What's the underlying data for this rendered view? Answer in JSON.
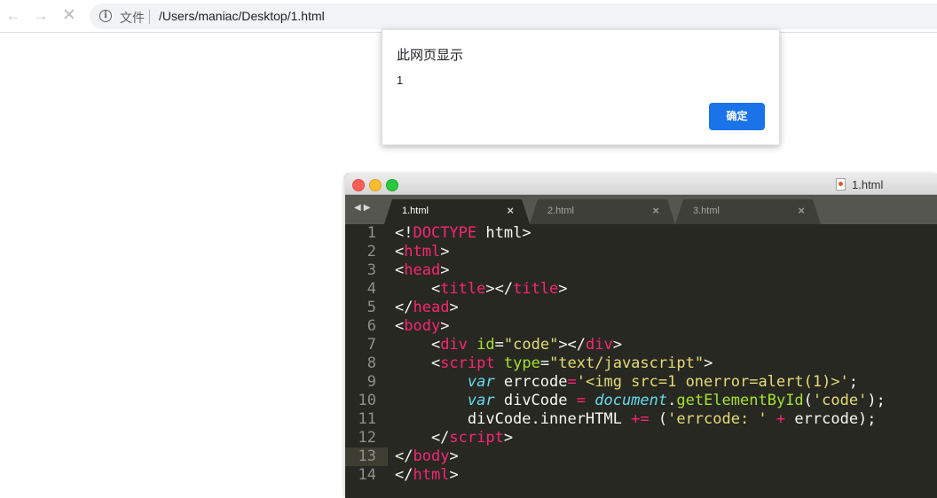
{
  "browser": {
    "scheme_label": "文件",
    "url": "/Users/maniac/Desktop/1.html"
  },
  "alert": {
    "title": "此网页显示",
    "message": "1",
    "ok_label": "确定"
  },
  "editor": {
    "window_title": "1.html",
    "tabs": [
      {
        "label": "1.html",
        "active": true
      },
      {
        "label": "2.html",
        "active": false
      },
      {
        "label": "3.html",
        "active": false
      }
    ],
    "current_line": 13,
    "lines": [
      [
        [
          "p",
          "<!"
        ],
        [
          "t",
          "DOCTYPE"
        ],
        [
          "p",
          " html>"
        ]
      ],
      [
        [
          "p",
          "<"
        ],
        [
          "t",
          "html"
        ],
        [
          "p",
          ">"
        ]
      ],
      [
        [
          "p",
          "<"
        ],
        [
          "t",
          "head"
        ],
        [
          "p",
          ">"
        ]
      ],
      [
        [
          "p",
          "    <"
        ],
        [
          "t",
          "title"
        ],
        [
          "p",
          "></"
        ],
        [
          "t",
          "title"
        ],
        [
          "p",
          ">"
        ]
      ],
      [
        [
          "p",
          "</"
        ],
        [
          "t",
          "head"
        ],
        [
          "p",
          ">"
        ]
      ],
      [
        [
          "p",
          "<"
        ],
        [
          "t",
          "body"
        ],
        [
          "p",
          ">"
        ]
      ],
      [
        [
          "p",
          "    <"
        ],
        [
          "t",
          "div"
        ],
        [
          "p",
          " "
        ],
        [
          "a",
          "id"
        ],
        [
          "p",
          "="
        ],
        [
          "s",
          "\"code\""
        ],
        [
          "p",
          "></"
        ],
        [
          "t",
          "div"
        ],
        [
          "p",
          ">"
        ]
      ],
      [
        [
          "p",
          "    <"
        ],
        [
          "t",
          "script"
        ],
        [
          "p",
          " "
        ],
        [
          "a",
          "type"
        ],
        [
          "p",
          "="
        ],
        [
          "s",
          "\"text/javascript\""
        ],
        [
          "p",
          ">"
        ]
      ],
      [
        [
          "p",
          "        "
        ],
        [
          "k",
          "var"
        ],
        [
          "p",
          " errcode"
        ],
        [
          "t",
          "="
        ],
        [
          "s",
          "'<img src=1 onerror=alert(1)>'"
        ],
        [
          "p",
          ";"
        ]
      ],
      [
        [
          "p",
          "        "
        ],
        [
          "k",
          "var"
        ],
        [
          "p",
          " divCode "
        ],
        [
          "t",
          "="
        ],
        [
          "p",
          " "
        ],
        [
          "k",
          "document"
        ],
        [
          "p",
          "."
        ],
        [
          "a",
          "getElementById"
        ],
        [
          "p",
          "("
        ],
        [
          "s",
          "'code'"
        ],
        [
          "p",
          ");"
        ]
      ],
      [
        [
          "p",
          "        divCode.innerHTML "
        ],
        [
          "t",
          "+="
        ],
        [
          "p",
          " ("
        ],
        [
          "s",
          "'errcode: '"
        ],
        [
          "p",
          " "
        ],
        [
          "t",
          "+"
        ],
        [
          "p",
          " errcode);"
        ]
      ],
      [
        [
          "p",
          "    </"
        ],
        [
          "t",
          "script"
        ],
        [
          "p",
          ">"
        ]
      ],
      [
        [
          "p",
          "</"
        ],
        [
          "t",
          "body"
        ],
        [
          "p",
          ">"
        ]
      ],
      [
        [
          "p",
          "</"
        ],
        [
          "t",
          "html"
        ],
        [
          "p",
          ">"
        ]
      ]
    ]
  },
  "colors": {
    "tag": "#f92672",
    "string": "#e6db74",
    "attribute": "#a6e22e",
    "keyword": "#66d9ef",
    "plain": "#f8f8f2",
    "editor_bg": "#272822",
    "button_blue": "#1a73e8"
  },
  "icons": [
    "back-arrow-icon",
    "forward-arrow-icon",
    "stop-icon",
    "info-icon",
    "html-file-icon",
    "close-icon"
  ]
}
